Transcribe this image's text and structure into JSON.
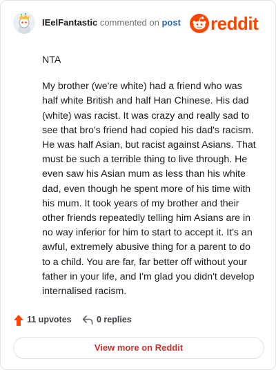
{
  "comment": {
    "author": "IEelFantastic",
    "action": "commented on",
    "post_link": "post",
    "verdict": "NTA",
    "text": "My brother (we're white) had a friend who was half white British and half Han Chinese. His dad (white) was racist. It was crazy and really sad to see that bro's friend had copied his dad's racism. He was half Asian, but racist against Asians. That must be such a terrible thing to live through. He even saw his Asian mum as less than his white dad, even though he spent more of his time with his mum. It took years of my brother and their other friends repeatedly telling him Asians are in no way inferior for him to start to accept it. It's an awful, extremely abusive thing for a parent to do to a child. You are far, far better off without your father in your life, and I'm glad you didn't develop internalised racism.",
    "upvotes": "11 upvotes",
    "replies": "0 replies"
  },
  "brand": {
    "wordmark": "reddit",
    "color": "#ff4500"
  },
  "footer": {
    "view_more_label": "View more on Reddit"
  },
  "icons": {
    "brand": "reddit-alien-icon",
    "upvote": "upvote-arrow-icon",
    "reply": "reply-arrow-icon",
    "avatar": "avatar-snoo"
  }
}
